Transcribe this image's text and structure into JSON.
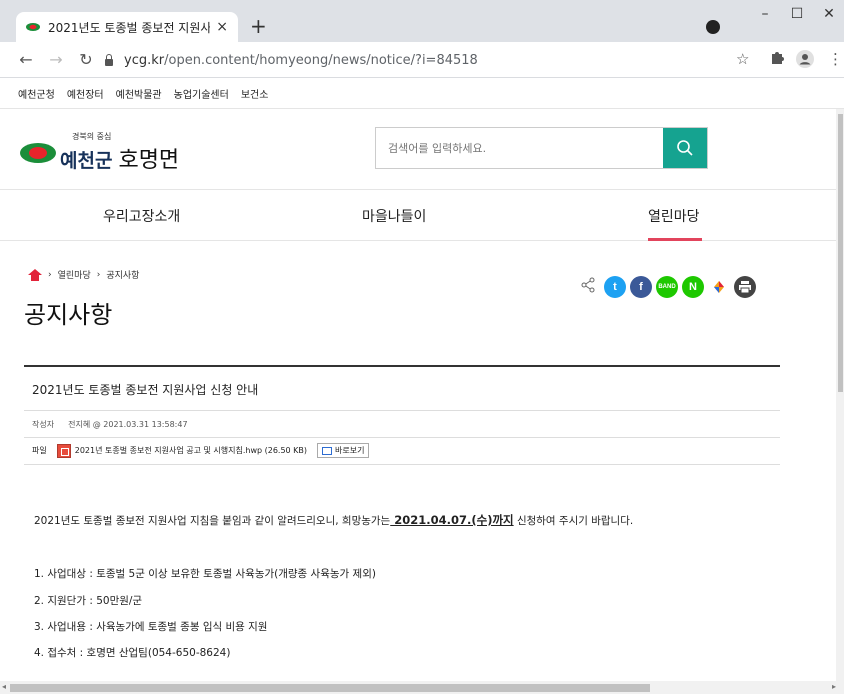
{
  "browser": {
    "tab_title": "2021년도 토종벌 종보전 지원사",
    "tab_close": "×",
    "new_tab": "+",
    "url_host": "ycg.kr",
    "url_path": "/open.content/homyeong/news/notice/?i=84518",
    "win_min": "–",
    "win_max": "☐",
    "win_close": "✕"
  },
  "bookmarks": [
    "예천군청",
    "예천장터",
    "예천박물관",
    "농업기술센터",
    "보건소"
  ],
  "header": {
    "logo_small": "경북의 중심",
    "logo_name": "예천군",
    "logo_sub": "호명면",
    "search_placeholder": "검색어를 입력하세요."
  },
  "gnb": [
    "우리고장소개",
    "마을나들이",
    "열린마당"
  ],
  "breadcrumb": [
    "열린마당",
    "공지사항"
  ],
  "page_title": "공지사항",
  "share": {
    "twitter": "t",
    "facebook": "f",
    "band": "BAND",
    "naver": "N"
  },
  "post": {
    "title": "2021년도 토종벌 종보전 지원사업 신청 안내",
    "author_label": "작성자",
    "author_value": "전지혜 @ 2021.03.31 13:58:47",
    "file_label": "파일",
    "file_name": "2021년 토종벌 종보전 지원사업 공고 및 시행지침.hwp (26.50 KB)",
    "view_label": "바로보기",
    "intro_before": "2021년도 토종벌 종보전 지원사업 지침을 붙임과 같이 알려드리오니, 희망농가는",
    "intro_deadline": " 2021.04.07.(수)까지",
    "intro_after": " 신청하여 주시기 바랍니다.",
    "items": [
      "1. 사업대상 : 토종벌 5군 이상 보유한 토종벌 사육농가(개량종 사육농가 제외)",
      "2. 지원단가 : 50만원/군",
      "3. 사업내용 : 사육농가에 토종벌 종봉 입식 비용 지원",
      "4. 접수처 : 호명면 산업팀(054-650-8624)"
    ]
  },
  "colors": {
    "accent_green": "#15a390",
    "accent_red": "#e2445c",
    "twitter": "#1da1f2",
    "facebook": "#3b5998",
    "naver": "#1ec800"
  }
}
